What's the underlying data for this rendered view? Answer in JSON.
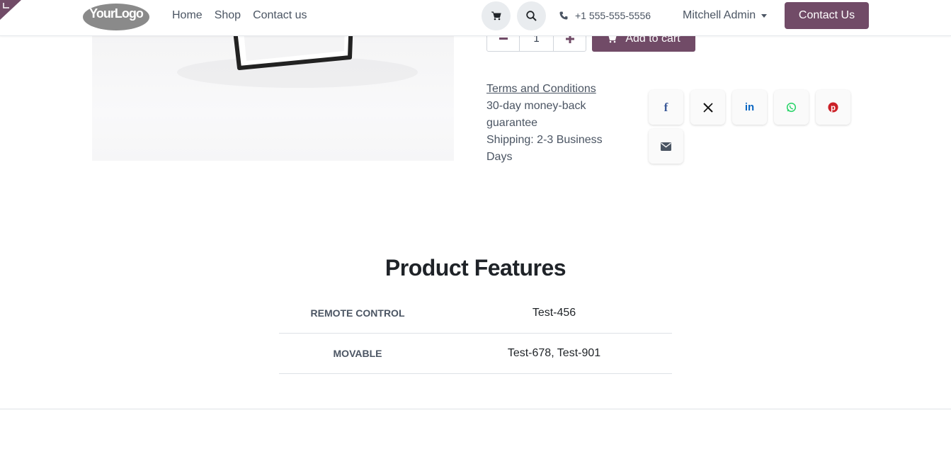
{
  "header": {
    "logo_text": "YourLogo",
    "nav": [
      "Home",
      "Shop",
      "Contact us"
    ],
    "phone": "+1 555-555-5556",
    "user": "Mitchell Admin",
    "contact_button": "Contact Us"
  },
  "product": {
    "quantity": "1",
    "add_to_cart": "Add to cart",
    "terms_link": "Terms and Conditions",
    "guarantee": "30-day money-back guarantee",
    "shipping": "Shipping: 2-3 Business Days"
  },
  "share": {
    "icons": [
      "facebook-icon",
      "x-icon",
      "linkedin-icon",
      "whatsapp-icon",
      "pinterest-icon",
      "email-icon"
    ]
  },
  "features": {
    "title": "Product Features",
    "rows": [
      {
        "name": "REMOTE CONTROL",
        "value": "Test-456"
      },
      {
        "name": "MOVABLE",
        "value": "Test-678, Test-901"
      }
    ]
  },
  "colors": {
    "brand": "#714b67",
    "facebook": "#3b5998",
    "linkedin": "#0a66c2",
    "whatsapp": "#25d366",
    "pinterest": "#cb2027"
  }
}
